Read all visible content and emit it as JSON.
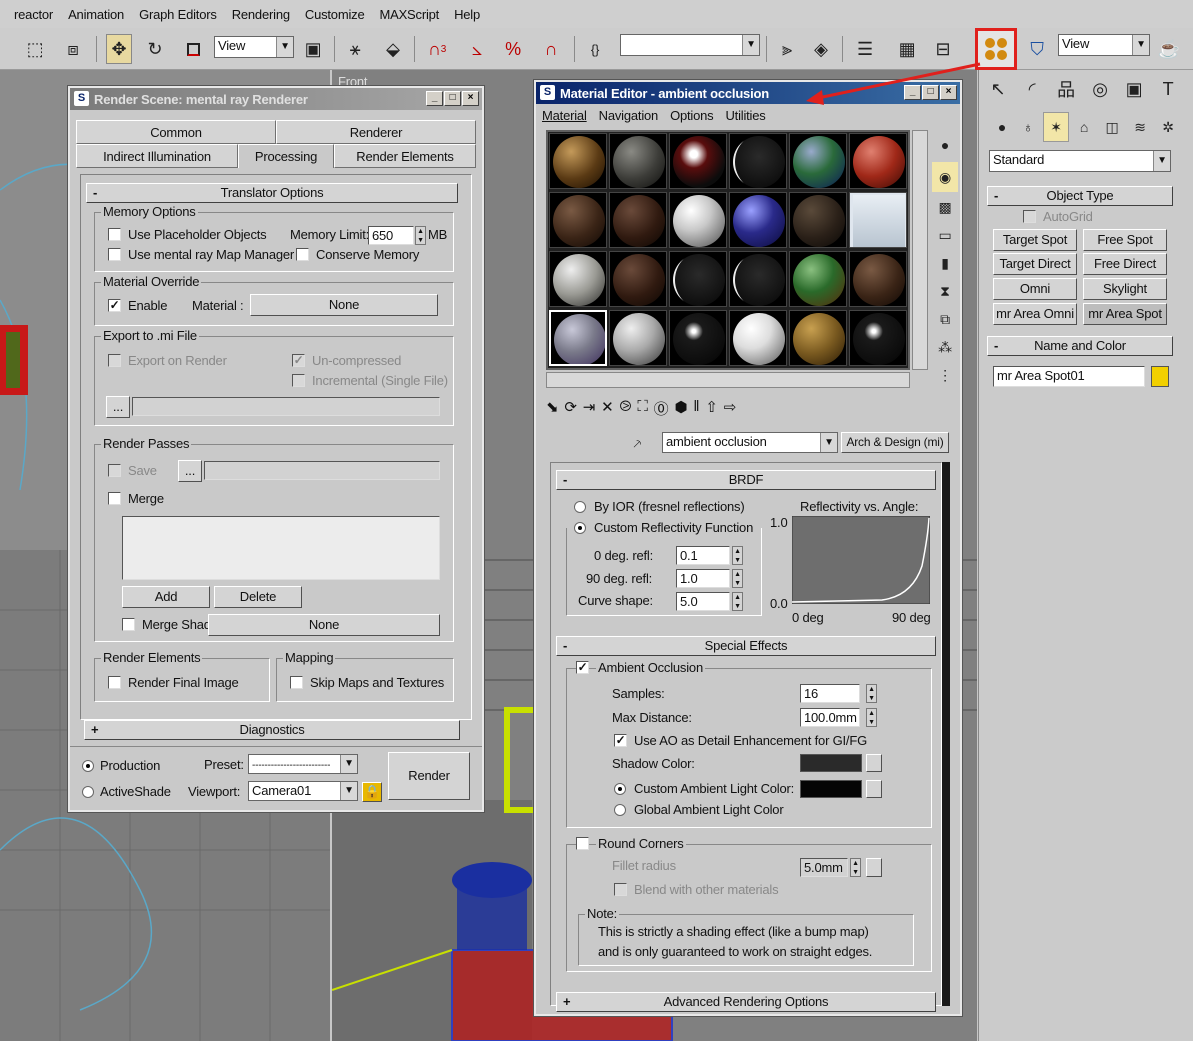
{
  "menubar": [
    "reactor",
    "Animation",
    "Graph Editors",
    "Rendering",
    "Customize",
    "MAXScript",
    "Help"
  ],
  "toolbar": {
    "view_combo_1": "View",
    "view_combo_2": "View",
    "named_selection": "",
    "highlight_color": "#e0201c",
    "icons": [
      "select-region-icon",
      "window-crossing-icon",
      "move-icon",
      "rotate-icon",
      "scale-icon",
      "snap-icon",
      "angle-snap-icon",
      "percent-snap-icon",
      "spinner-snap-icon",
      "mirror-icon",
      "align-icon",
      "layer-icon",
      "curve-editor-icon",
      "schematic-icon",
      "material-editor-icon",
      "render-setup-icon",
      "render-teapot-icon"
    ]
  },
  "render_scene": {
    "title": "Render Scene: mental ray Renderer",
    "tabs": [
      "Common",
      "Renderer",
      "Indirect Illumination",
      "Processing",
      "Render Elements"
    ],
    "selected_tab": "Processing",
    "translator_title": "Translator Options",
    "memory_options": {
      "title": "Memory Options",
      "use_placeholder": "Use Placeholder Objects",
      "memory_limit_label": "Memory Limit:",
      "memory_limit": "650",
      "memory_unit": "MB",
      "use_map_manager": "Use mental ray Map Manager",
      "conserve_memory": "Conserve Memory"
    },
    "material_override": {
      "title": "Material Override",
      "enable": "Enable",
      "material_label": "Material :",
      "material_value": "None"
    },
    "export_mi": {
      "title": "Export to .mi File",
      "export_on_render": "Export on Render",
      "uncompressed": "Un-compressed",
      "incremental": "Incremental (Single File)",
      "browse": "...",
      "path": ""
    },
    "render_passes": {
      "title": "Render Passes",
      "save": "Save",
      "browse": "...",
      "path": "",
      "merge": "Merge",
      "add": "Add",
      "delete": "Delete",
      "merge_shader": "Merge Shader:",
      "merge_shader_value": "None"
    },
    "render_elements": {
      "title": "Render Elements",
      "render_final": "Render Final Image"
    },
    "mapping": {
      "title": "Mapping",
      "skip_maps": "Skip Maps and Textures"
    },
    "diagnostics_title": "Diagnostics",
    "production": "Production",
    "activeshade": "ActiveShade",
    "preset_label": "Preset:",
    "preset_value": "-------------------------",
    "viewport_label": "Viewport:",
    "viewport_value": "Camera01",
    "render_button": "Render"
  },
  "material_editor": {
    "title": "Material Editor - ambient occlusion",
    "menu": [
      "Material",
      "Navigation",
      "Options",
      "Utilities"
    ],
    "material_name": "ambient occlusion",
    "material_type": "Arch & Design (mi)",
    "brdf": {
      "title": "BRDF",
      "by_ior": "By IOR (fresnel reflections)",
      "custom_fn": "Custom Reflectivity Function",
      "deg0_label": "0 deg. refl:",
      "deg0_value": "0.1",
      "deg90_label": "90 deg. refl:",
      "deg90_value": "1.0",
      "curve_label": "Curve shape:",
      "curve_value": "5.0",
      "graph_title": "Reflectivity vs. Angle:",
      "y_max": "1.0",
      "y_min": "0.0",
      "x_min": "0 deg",
      "x_max": "90 deg"
    },
    "special_effects": {
      "title": "Special Effects",
      "ao": "Ambient Occlusion",
      "samples_label": "Samples:",
      "samples": "16",
      "max_dist_label": "Max Distance:",
      "max_dist": "100.0mm",
      "use_ao_detail": "Use AO as Detail Enhancement for GI/FG",
      "shadow_color_label": "Shadow Color:",
      "shadow_color": "#2a2a2a",
      "custom_ambient": "Custom Ambient Light Color:",
      "custom_ambient_color": "#050505",
      "global_ambient": "Global Ambient Light Color",
      "round_corners": "Round Corners",
      "fillet_label": "Fillet radius",
      "fillet_value": "5.0mm",
      "blend": "Blend with other materials",
      "note_title": "Note:",
      "note_line1": "This is strictly a shading effect (like a bump map)",
      "note_line2": "and is only guaranteed to work on straight edges."
    },
    "advanced_title": "Advanced Rendering Options"
  },
  "command_panel": {
    "category": "Standard",
    "object_type_title": "Object Type",
    "autogrid": "AutoGrid",
    "buttons": [
      "Target Spot",
      "Free Spot",
      "Target Direct",
      "Free Direct",
      "Omni",
      "Skylight",
      "mr Area Omni",
      "mr Area Spot"
    ],
    "name_color_title": "Name and Color",
    "object_name": "mr Area Spot01",
    "object_color": "#f2d000"
  },
  "viewport_center_label": "Front"
}
